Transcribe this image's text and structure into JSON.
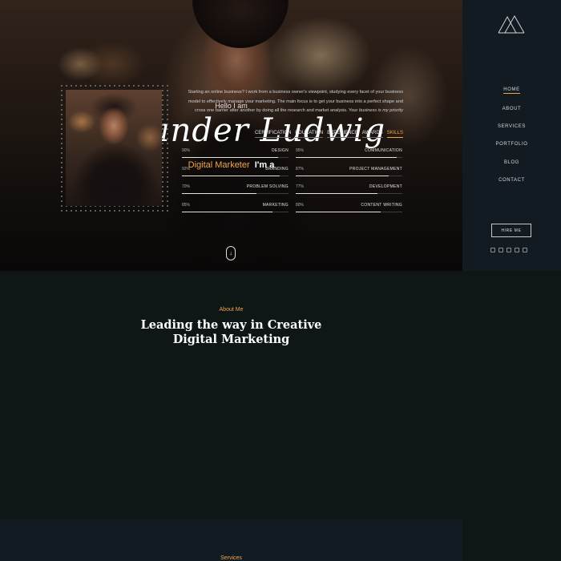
{
  "hero": {
    "greeting": "Hello I am",
    "name": "Alexander Ludwig",
    "role": "Digital Marketer",
    "role_suffix": "I'm a"
  },
  "sidebar": {
    "nav": [
      "HOME",
      "ABOUT",
      "SERVICES",
      "PORTFOLIO",
      "BLOG",
      "CONTACT"
    ],
    "active": "HOME",
    "hire_label": "HIRE ME",
    "socials": [
      "facebook-icon",
      "twitter-icon",
      "instagram-icon",
      "linkedin-icon",
      "youtube-icon"
    ]
  },
  "about": {
    "label": "About Me",
    "title_line1": "Leading the way in Creative",
    "title_line2": "Digital Marketing",
    "text": "Starting an online business? I work from a business owner's viewpoint, studying every facet of your business model to effectively manage your marketing. The main focus is to get your business into a perfect shape and cross one barrier after another by doing all the research and market analysis. Your",
    "text_em": "business is my priority",
    "tabs": [
      "CERTIFICATION",
      "EDUCATION",
      "EXPERIENCE",
      "AWARDS",
      "SKILLS"
    ],
    "active_tab": "SKILLS",
    "skills": [
      {
        "name": "DESIGN",
        "percent": 90,
        "label": "90%"
      },
      {
        "name": "COMMUNICATION",
        "percent": 95,
        "label": "95%"
      },
      {
        "name": "BRANDING",
        "percent": 92,
        "label": "92%"
      },
      {
        "name": "PROJECT MANAGEMENT",
        "percent": 87,
        "label": "87%"
      },
      {
        "name": "PROBLEM SOLVING",
        "percent": 70,
        "label": "70%"
      },
      {
        "name": "DEVELOPMENT",
        "percent": 77,
        "label": "77%"
      },
      {
        "name": "MARKETING",
        "percent": 85,
        "label": "85%"
      },
      {
        "name": "CONTENT WRITING",
        "percent": 80,
        "label": "80%"
      }
    ]
  },
  "services": {
    "label": "Services"
  },
  "colors": {
    "accent": "#f1a54a",
    "sidebar": "#131b22",
    "section": "#0f1616"
  }
}
